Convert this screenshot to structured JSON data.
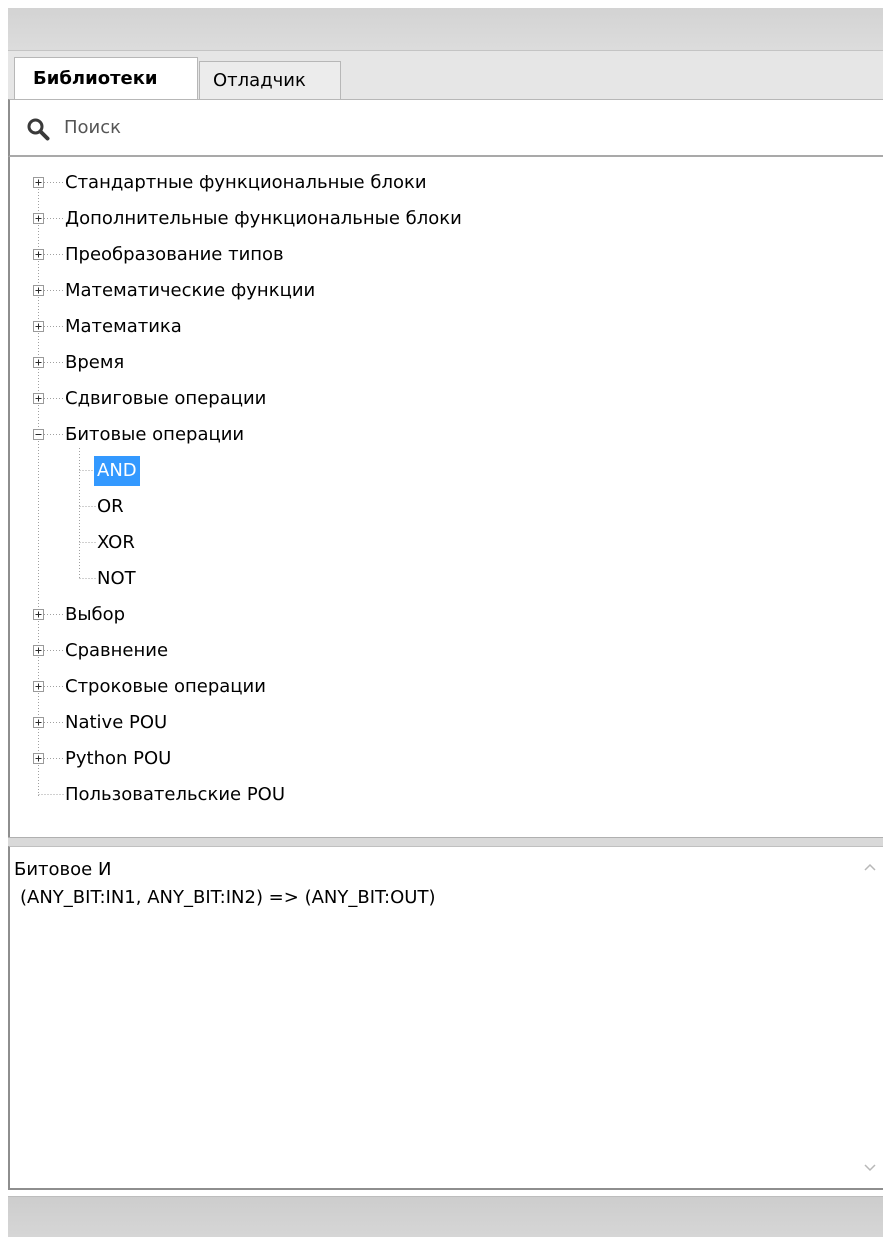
{
  "tabs": {
    "libraries": "Библиотеки",
    "debugger": "Отладчик"
  },
  "search": {
    "placeholder": "Поиск",
    "icon": "magnifier-icon"
  },
  "tree": {
    "items": [
      {
        "label": "Стандартные функциональные блоки",
        "expander": "plus"
      },
      {
        "label": "Дополнительные функциональные блоки",
        "expander": "plus"
      },
      {
        "label": "Преобразование типов",
        "expander": "plus"
      },
      {
        "label": "Математические функции",
        "expander": "plus"
      },
      {
        "label": "Математика",
        "expander": "plus"
      },
      {
        "label": "Время",
        "expander": "plus"
      },
      {
        "label": "Сдвиговые операции",
        "expander": "plus"
      },
      {
        "label": "Битовые операции",
        "expander": "minus",
        "children": [
          {
            "label": "AND",
            "selected": true
          },
          {
            "label": "OR"
          },
          {
            "label": "XOR"
          },
          {
            "label": "NOT"
          }
        ]
      },
      {
        "label": "Выбор",
        "expander": "plus"
      },
      {
        "label": "Сравнение",
        "expander": "plus"
      },
      {
        "label": "Строковые операции",
        "expander": "plus"
      },
      {
        "label": "Native POU",
        "expander": "plus"
      },
      {
        "label": "Python POU",
        "expander": "plus"
      },
      {
        "label": "Пользовательские POU",
        "expander": "none"
      }
    ]
  },
  "description": {
    "title": "Битовое И",
    "signature": "(ANY_BIT:IN1, ANY_BIT:IN2) => (ANY_BIT:OUT)"
  },
  "colors": {
    "selection": "#3399ff",
    "panel_border": "#8e8e8e",
    "tab_strip": "#e6e6e6"
  }
}
